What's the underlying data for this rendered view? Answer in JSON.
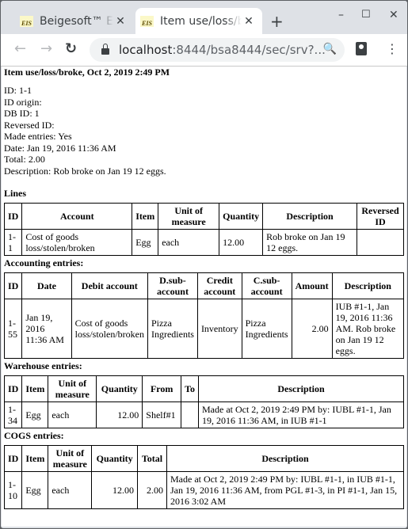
{
  "browser": {
    "tabs": [
      {
        "title": "Beigesoft™ Enterprise Information System",
        "favicon": "EIS",
        "active": false
      },
      {
        "title": "Item use/loss/broke",
        "favicon": "EIS",
        "active": true
      }
    ],
    "new_tab_label": "+",
    "window_controls": {
      "minimize": "–",
      "maximize": "☐",
      "close": "✕"
    },
    "nav": {
      "back": "←",
      "forward": "→",
      "reload": "↻"
    },
    "url_host": "localhost",
    "url_rest": ":8444/bsa8444/sec/srv?...",
    "zoom_icon": "🔍",
    "menu_icon": "⋮"
  },
  "document": {
    "title": "Item use/loss/broke, Oct 2, 2019 2:49 PM",
    "properties": [
      "ID: 1-1",
      "ID origin:",
      "DB ID: 1",
      "Reversed ID:",
      "Made entries: Yes",
      "Date: Jan 19, 2016 11:36 AM",
      "Total: 2.00",
      "Description: Rob broke on Jan 19 12 eggs."
    ]
  },
  "lines": {
    "heading": "Lines",
    "columns": [
      "ID",
      "Account",
      "Item",
      "Unit of measure",
      "Quantity",
      "Description",
      "Reversed ID"
    ],
    "rows": [
      [
        "1-1",
        "Cost of goods loss/stolen/broken",
        "Egg",
        "each",
        "12.00",
        "Rob broke on Jan 19 12 eggs.",
        ""
      ]
    ]
  },
  "accounting": {
    "heading": "Accounting entries:",
    "columns": [
      "ID",
      "Date",
      "Debit account",
      "D.sub-account",
      "Credit account",
      "C.sub-account",
      "Amount",
      "Description"
    ],
    "rows": [
      [
        "1-55",
        "Jan 19, 2016 11:36 AM",
        "Cost of goods loss/stolen/broken",
        "Pizza Ingredients",
        "Inventory",
        "Pizza Ingredients",
        "2.00",
        "IUB #1-1, Jan 19, 2016 11:36 AM. Rob broke on Jan 19 12 eggs."
      ]
    ]
  },
  "warehouse": {
    "heading": "Warehouse entries:",
    "columns": [
      "ID",
      "Item",
      "Unit of measure",
      "Quantity",
      "From",
      "To",
      "Description"
    ],
    "rows": [
      [
        "1-34",
        "Egg",
        "each",
        "12.00",
        "Shelf#1",
        "",
        "Made at Oct 2, 2019 2:49 PM by: IUBL #1-1, Jan 19, 2016 11:36 AM, in IUB #1-1"
      ]
    ]
  },
  "cogs": {
    "heading": "COGS entries:",
    "columns": [
      "ID",
      "Item",
      "Unit of measure",
      "Quantity",
      "Total",
      "Description"
    ],
    "rows": [
      [
        "1-10",
        "Egg",
        "each",
        "12.00",
        "2.00",
        "Made at Oct 2, 2019 2:49 PM by: IUBL #1-1, in IUB #1-1, Jan 19, 2016 11:36 AM, from PGL #1-3, in PI #1-1, Jan 15, 2016 3:02 AM"
      ]
    ]
  }
}
